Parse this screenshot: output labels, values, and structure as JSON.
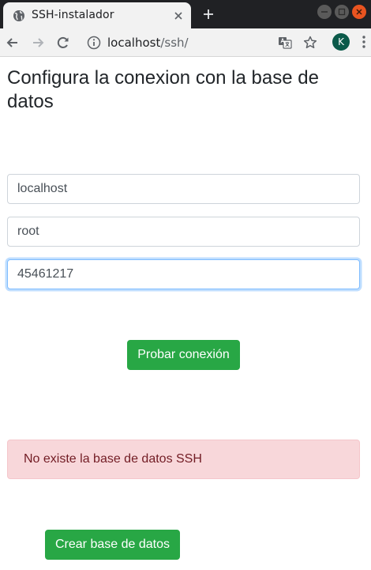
{
  "browser": {
    "tab_title": "SSH-instalador",
    "url_host": "localhost",
    "url_path": "/ssh/",
    "profile_initial": "K",
    "icons": [
      "globe-icon",
      "close-icon",
      "plus-icon",
      "back-arrow-icon",
      "forward-arrow-icon",
      "reload-icon",
      "info-icon",
      "translate-icon",
      "star-icon"
    ]
  },
  "page": {
    "title": "Configura la conexion con la base de datos",
    "fields": {
      "host": "localhost",
      "user": "root",
      "password": "45461217"
    },
    "test_button": "Probar conexión",
    "alert": "No existe la base de datos SSH",
    "create_button": "Crear base de datos"
  },
  "colors": {
    "success": "#28a745",
    "danger_bg": "#f8d7da",
    "danger_text": "#721c24",
    "focus_border": "#80bdff"
  }
}
